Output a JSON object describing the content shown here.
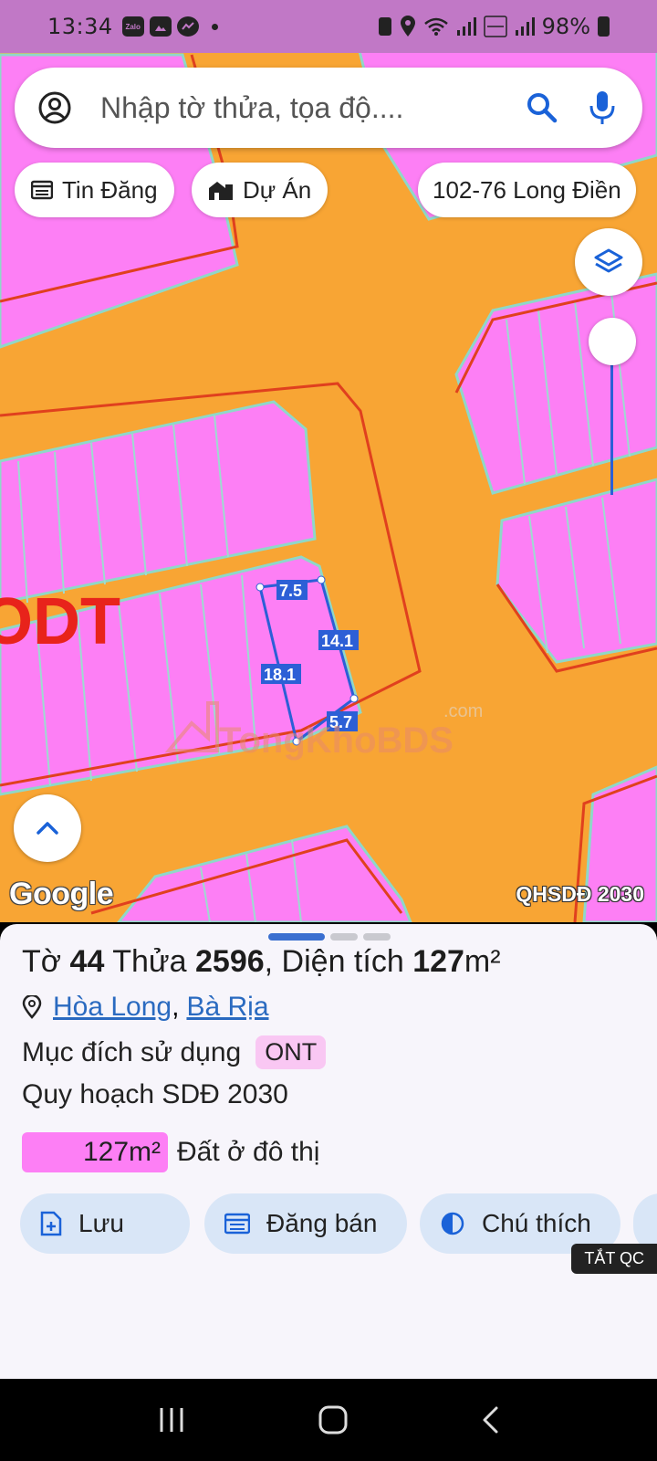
{
  "status_bar": {
    "time": "13:34",
    "battery": "98%",
    "app_icons": [
      "zalo-icon",
      "gallery-icon",
      "messenger-icon"
    ],
    "zalo_label": "Zalo"
  },
  "search": {
    "placeholder": "Nhập tờ thửa, tọa độ...."
  },
  "chips": {
    "listings": "Tin Đăng",
    "projects": "Dự Án",
    "location": "102-76 Long Điền"
  },
  "map": {
    "zone_label": "ODT",
    "edges": [
      "7.5",
      "14.1",
      "18.1",
      "5.7"
    ],
    "watermark": "TongKhoBDS",
    "watermark_domain": ".com",
    "attribution": "Google",
    "plan_label": "QHSDĐ 2030",
    "colors": {
      "residential": "#fd7ff5",
      "road": "#f8a534",
      "parcel_outline": "#2c5fd6"
    }
  },
  "parcel": {
    "sheet_prefix": "Tờ",
    "sheet_no": "44",
    "parcel_prefix": "Thửa",
    "parcel_no": "2596",
    "area_prefix": ", Diện tích",
    "area_value": "127",
    "area_unit": "m²",
    "ward": "Hòa Long",
    "separator": ",",
    "city": "Bà Rịa",
    "purpose_label": "Mục đích sử dụng",
    "purpose_code": "ONT",
    "plan_title": "Quy hoạch SDĐ 2030",
    "plan_area": "127m²",
    "plan_type": "Đất ở đô thị"
  },
  "actions": {
    "save": "Lưu",
    "post_sale": "Đăng bán",
    "legend": "Chú thích"
  },
  "ad_badge": "TẮT QC"
}
